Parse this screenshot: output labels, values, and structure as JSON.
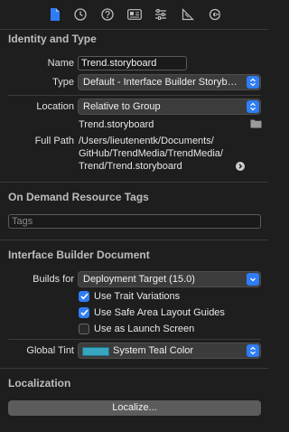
{
  "toolbar": {
    "icons": [
      "file-inspector-icon",
      "history-inspector-icon",
      "quick-help-icon",
      "identity-inspector-icon",
      "attributes-inspector-icon",
      "size-inspector-icon",
      "connections-inspector-icon"
    ],
    "accent": "#2f7df6"
  },
  "identity": {
    "title": "Identity and Type",
    "name_label": "Name",
    "name_value": "Trend.storyboard",
    "type_label": "Type",
    "type_value": "Default - Interface Builder Storyboard",
    "location_label": "Location",
    "location_value": "Relative to Group",
    "location_file": "Trend.storyboard",
    "fullpath_label": "Full Path",
    "fullpath_lines": [
      "/Users/lieutenentk/Documents/",
      "GitHub/TrendMedia/TrendMedia/",
      "Trend/Trend.storyboard"
    ]
  },
  "tags": {
    "title": "On Demand Resource Tags",
    "placeholder": "Tags"
  },
  "ib": {
    "title": "Interface Builder Document",
    "builds_for_label": "Builds for",
    "builds_for_value": "Deployment Target (15.0)",
    "checkboxes": [
      {
        "label": "Use Trait Variations",
        "checked": true
      },
      {
        "label": "Use Safe Area Layout Guides",
        "checked": true
      },
      {
        "label": "Use as Launch Screen",
        "checked": false
      }
    ],
    "global_tint_label": "Global Tint",
    "global_tint_value": "System Teal Color",
    "tint_color": "#39a6c0"
  },
  "localization": {
    "title": "Localization",
    "button_label": "Localize..."
  }
}
